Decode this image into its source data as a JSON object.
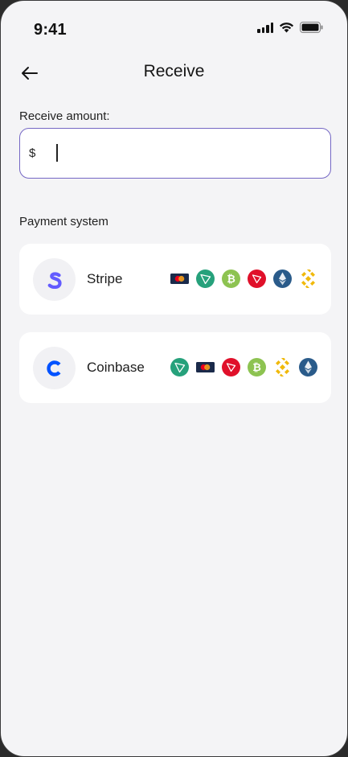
{
  "status_bar": {
    "time": "9:41"
  },
  "header": {
    "title": "Receive"
  },
  "amount": {
    "label": "Receive amount:",
    "prefix": "$",
    "value": ""
  },
  "payment": {
    "section_label": "Payment system",
    "systems": [
      {
        "name": "Stripe",
        "methods": [
          "mastercard-icon",
          "tron-icon",
          "bitcoin-icon",
          "tron-red-icon",
          "ethereum-icon",
          "binance-icon"
        ]
      },
      {
        "name": "Coinbase",
        "methods": [
          "tron-icon",
          "mastercard-icon",
          "tron-red-icon",
          "bitcoin-icon",
          "binance-icon",
          "ethereum-icon"
        ]
      }
    ]
  },
  "colors": {
    "background": "#f4f4f6",
    "input_border": "#7467c4",
    "stripe": "#635bff",
    "coinbase": "#0052ff",
    "tron_green": "#26a17b",
    "bitcoin": "#8dc351",
    "tron_red": "#e0102a",
    "ethereum": "#2a5b8a",
    "binance": "#f0b90b"
  }
}
